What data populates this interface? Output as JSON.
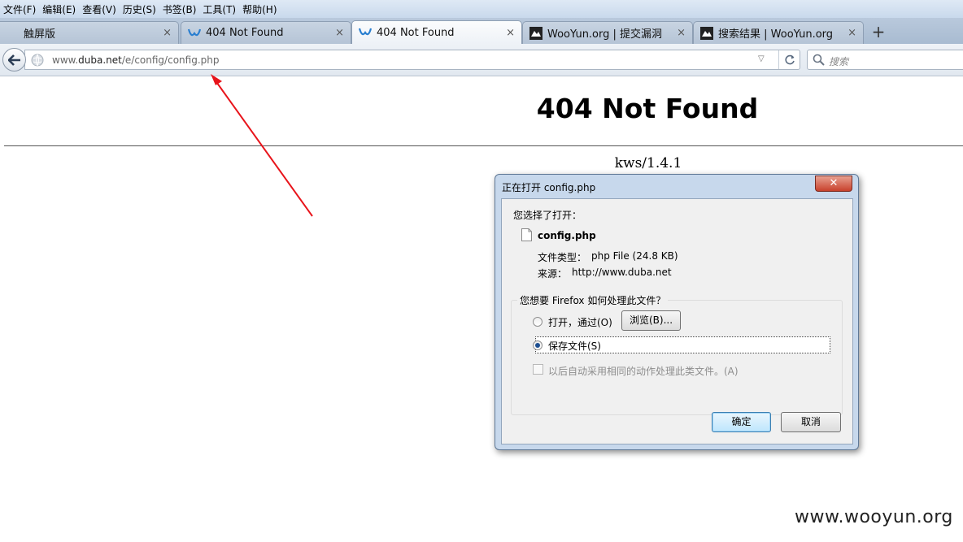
{
  "menu": [
    "文件(F)",
    "编辑(E)",
    "查看(V)",
    "历史(S)",
    "书签(B)",
    "工具(T)",
    "帮助(H)"
  ],
  "tabs": [
    {
      "label": "触屏版",
      "close": "×"
    },
    {
      "label": "404 Not Found",
      "close": "×"
    },
    {
      "label": "404 Not Found",
      "close": "×"
    },
    {
      "label": "WooYun.org | 提交漏洞",
      "close": "×"
    },
    {
      "label": "搜索结果 | WooYun.org",
      "close": "×"
    }
  ],
  "new_tab": "+",
  "address": {
    "prefix": "www.",
    "host": "duba.net",
    "path": "/e/config/config.php"
  },
  "search": {
    "placeholder": "搜索"
  },
  "page": {
    "heading": "404 Not Found",
    "server": "kws/1.4.1"
  },
  "dialog": {
    "title": "正在打开 config.php",
    "close": "✕",
    "chosen_label": "您选择了打开：",
    "file_name": "config.php",
    "type_label": "文件类型：",
    "type_value": "php File (24.8 KB)",
    "source_label": "来源：",
    "source_value": "http://www.duba.net",
    "question": "您想要 Firefox 如何处理此文件？",
    "option_open": "打开，通过(O)",
    "browse_button": "浏览(B)...",
    "option_save": "保存文件(S)",
    "remember": "以后自动采用相同的动作处理此类文件。(A)",
    "ok": "确定",
    "cancel": "取消",
    "selected_option": "save"
  },
  "watermark": "www.wooyun.org"
}
